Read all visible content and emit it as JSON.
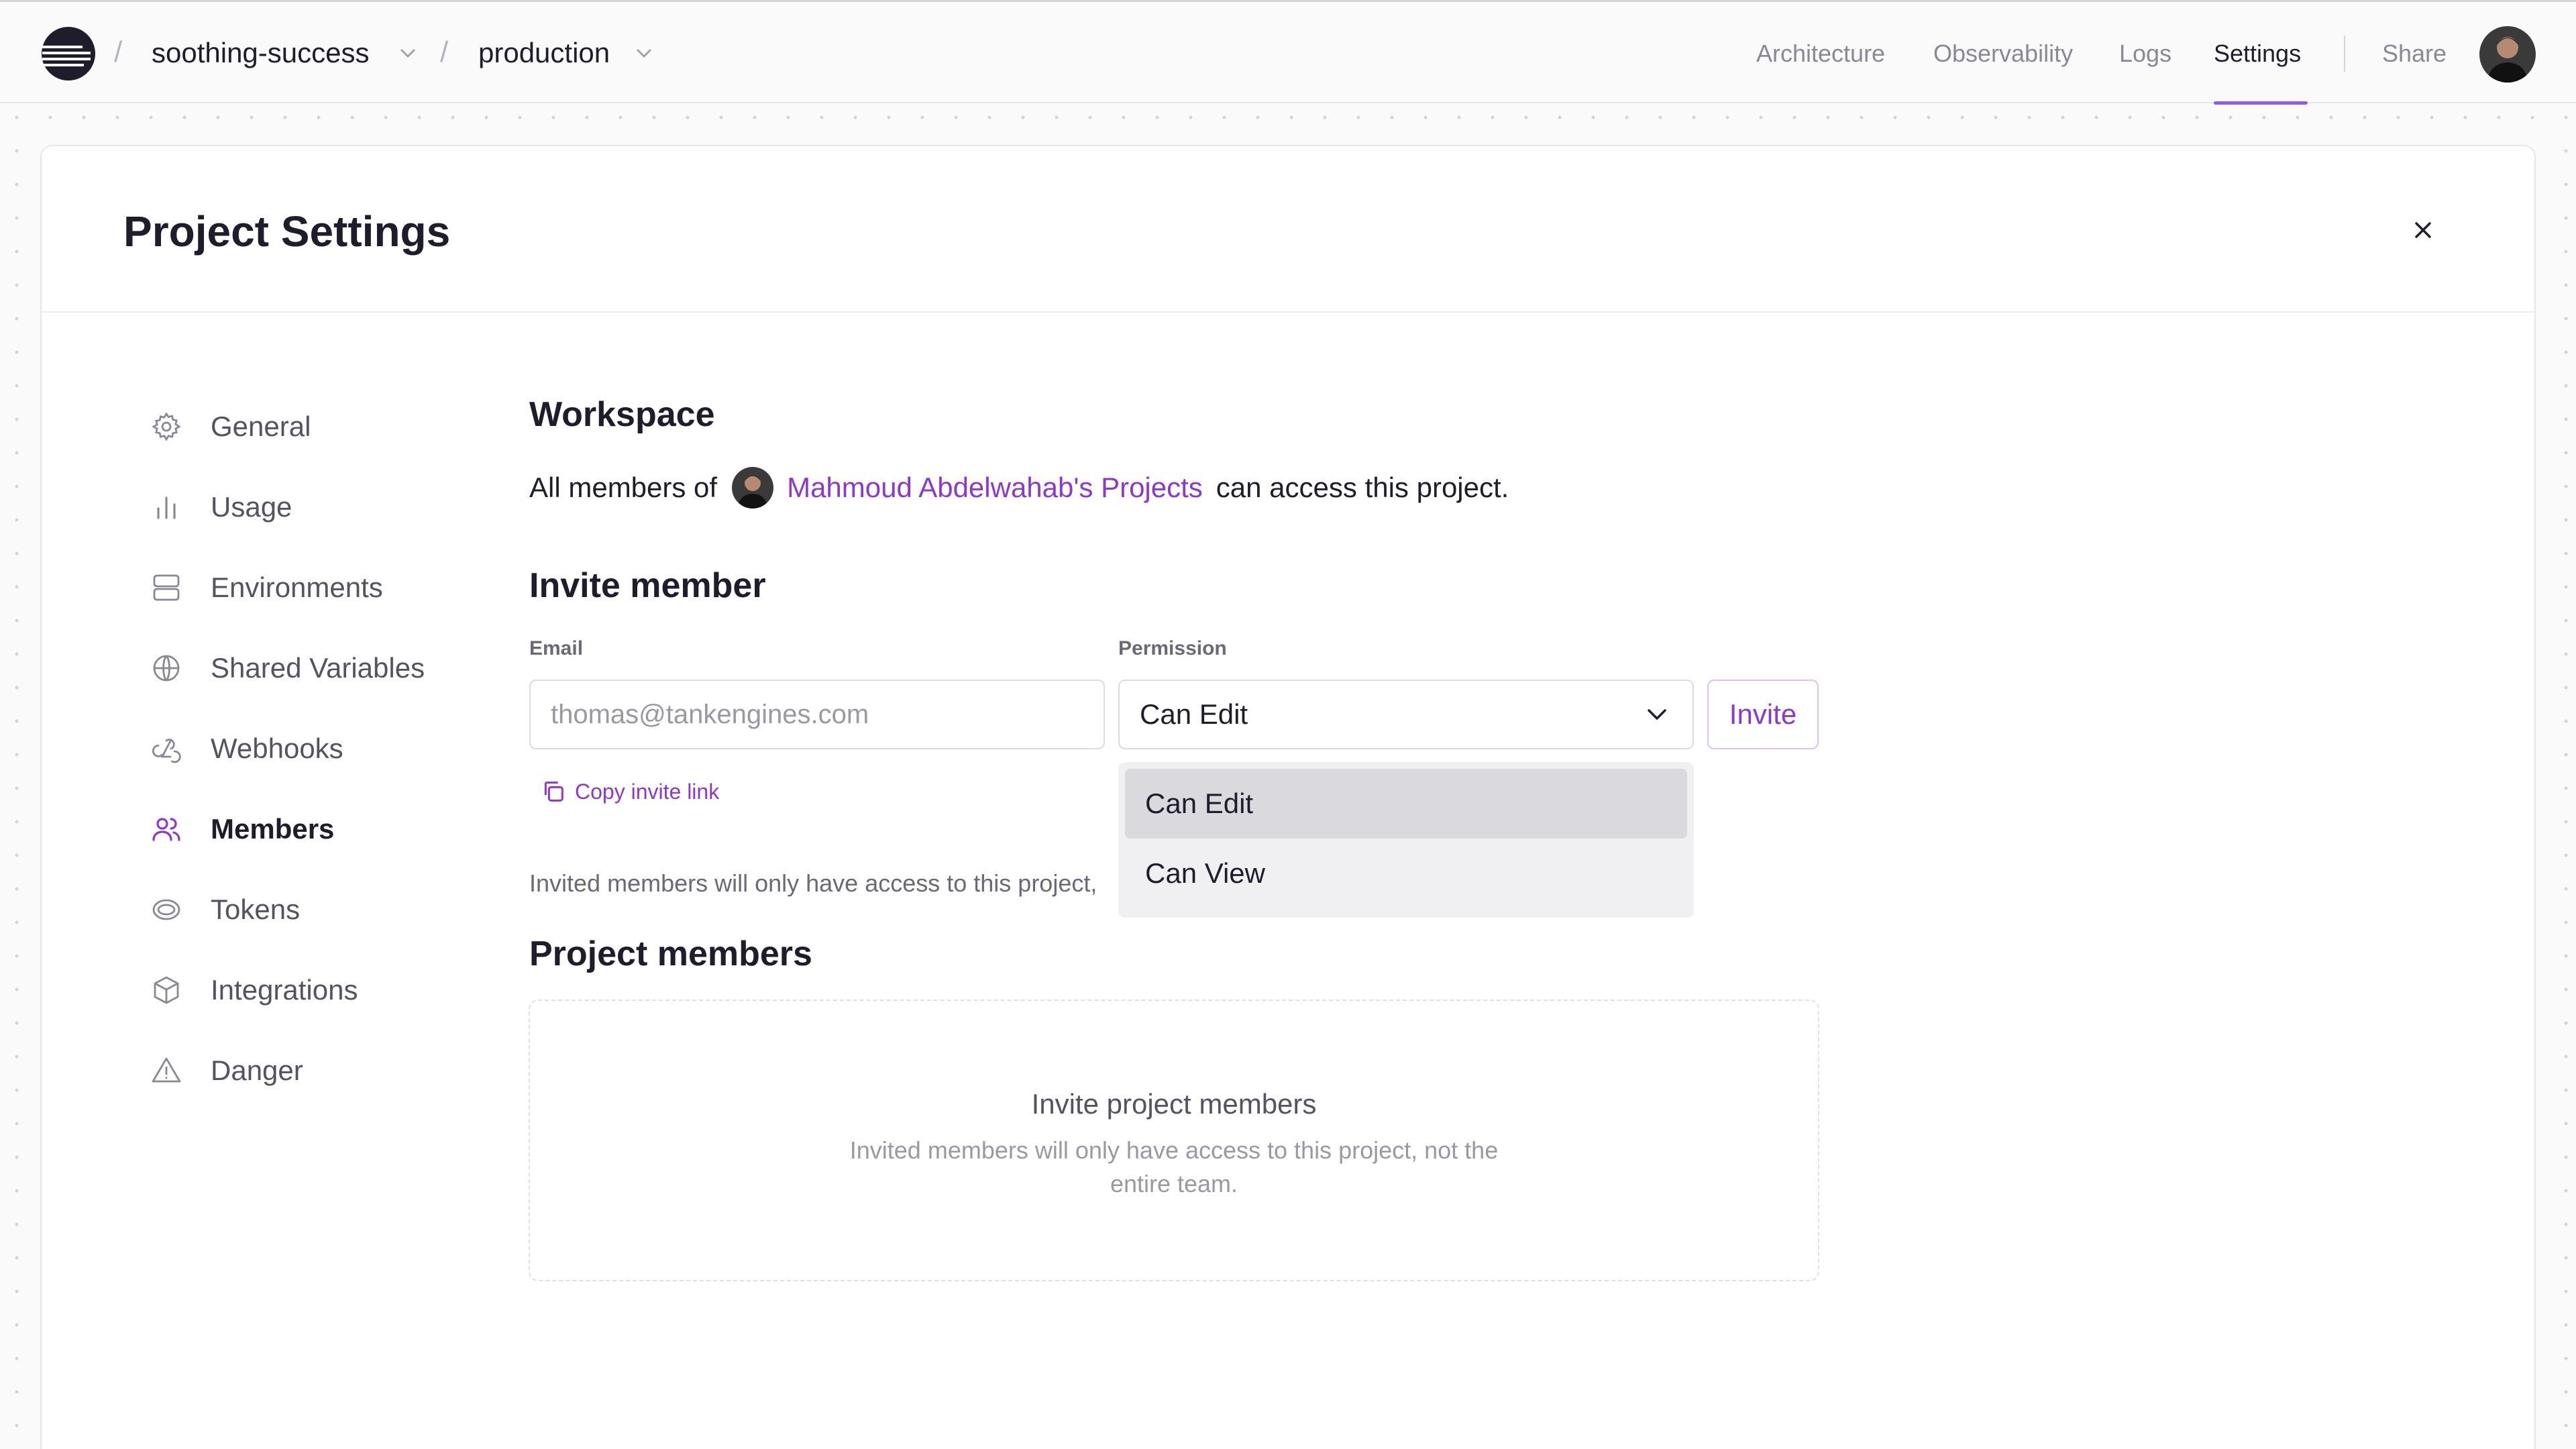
{
  "breadcrumb": {
    "project": "soothing-success",
    "environment": "production",
    "separator": "/"
  },
  "topnav": {
    "items": [
      "Architecture",
      "Observability",
      "Logs",
      "Settings"
    ],
    "active": "Settings",
    "share_label": "Share"
  },
  "modal": {
    "title": "Project Settings",
    "close_icon": "close-icon"
  },
  "sidebar": {
    "items": [
      {
        "label": "General",
        "icon": "gear-icon"
      },
      {
        "label": "Usage",
        "icon": "bar-chart-icon"
      },
      {
        "label": "Environments",
        "icon": "server-icon"
      },
      {
        "label": "Shared Variables",
        "icon": "globe-icon"
      },
      {
        "label": "Webhooks",
        "icon": "webhook-icon"
      },
      {
        "label": "Members",
        "icon": "users-icon"
      },
      {
        "label": "Tokens",
        "icon": "token-icon"
      },
      {
        "label": "Integrations",
        "icon": "cube-icon"
      },
      {
        "label": "Danger",
        "icon": "warning-icon"
      }
    ],
    "active": "Members"
  },
  "workspace": {
    "heading": "Workspace",
    "prefix": "All members of",
    "link": "Mahmoud Abdelwahab's Projects",
    "suffix": "can access this project."
  },
  "invite": {
    "heading": "Invite member",
    "email_label": "Email",
    "email_placeholder": "thomas@tankengines.com",
    "permission_label": "Permission",
    "permission_value": "Can Edit",
    "invite_button": "Invite",
    "copy_link": "Copy invite link",
    "helper_text": "Invited members will only have access to this project,",
    "options": [
      "Can Edit",
      "Can View"
    ],
    "selected_option": "Can Edit"
  },
  "project_members": {
    "heading": "Project members",
    "empty_title": "Invite project members",
    "empty_subtitle": "Invited members will only have access to this project, not the entire team."
  },
  "colors": {
    "accent": "#8e38c8",
    "nav_underline": "#8b5cf6",
    "text": "#1f1d2b",
    "muted": "#6b6975"
  }
}
